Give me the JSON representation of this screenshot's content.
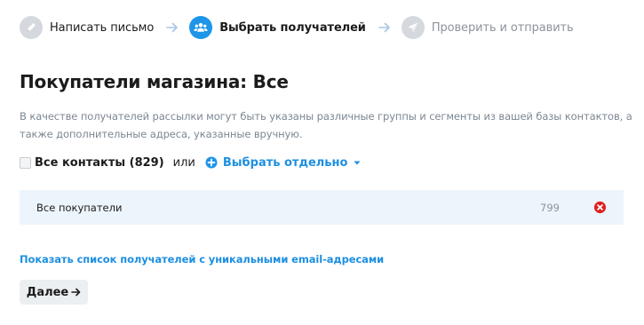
{
  "steps": [
    {
      "label": "Написать письмо",
      "icon": "pencil-icon",
      "state": "done"
    },
    {
      "label": "Выбрать получателей",
      "icon": "users-icon",
      "state": "active"
    },
    {
      "label": "Проверить и отправить",
      "icon": "send-icon",
      "state": "upcoming"
    }
  ],
  "page": {
    "title": "Покупатели магазина: Все",
    "description": "В качестве получателей рассылки могут быть указаны различные группы и сегменты из вашей базы контактов, а также дополнительные адреса, указанные вручную."
  },
  "contacts": {
    "all_label": "Все контакты (829)",
    "all_checked": false,
    "or_label": "или",
    "select_label": "Выбрать отдельно"
  },
  "recipients": [
    {
      "name": "Все покупатели",
      "count": "799"
    }
  ],
  "links": {
    "unique_emails": "Показать список получателей с уникальными email-адресами"
  },
  "actions": {
    "next_label": "Далее"
  },
  "colors": {
    "accent": "#1d95e8",
    "link": "#1d8fe0",
    "row_background": "#edf5fc",
    "remove": "#e02020",
    "inactive_step": "#d5d9de"
  }
}
